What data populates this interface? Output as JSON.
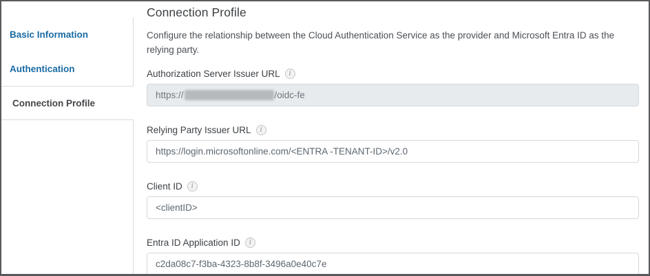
{
  "sidebar": {
    "items": [
      {
        "label": "Basic Information",
        "active": false
      },
      {
        "label": "Authentication",
        "active": false
      },
      {
        "label": "Connection Profile",
        "active": true
      }
    ]
  },
  "main": {
    "title": "Connection Profile",
    "description": "Configure the relationship between the Cloud Authentication Service as the provider and Microsoft Entra ID as the relying party.",
    "fields": [
      {
        "label": "Authorization Server Issuer URL",
        "state": "disabled",
        "value_prefix": "https://",
        "value_redacted": true,
        "value_suffix": "/oidc-fe"
      },
      {
        "label": "Relying Party Issuer URL",
        "state": "editable",
        "value": "https://login.microsoftonline.com/<ENTRA -TENANT-ID>/v2.0"
      },
      {
        "label": "Client ID",
        "state": "editable",
        "value": "<clientID>"
      },
      {
        "label": "Entra ID Application ID",
        "state": "editable",
        "value": "c2da08c7-f3ba-4323-8b8f-3496a0e40c7e"
      }
    ]
  },
  "icons": {
    "info": "i"
  },
  "colors": {
    "link_blue": "#1a6ba4",
    "active_text": "#424549",
    "divider": "#d8dadc",
    "page_border": "#58595b",
    "disabled_input_bg": "#e8ebee",
    "input_border": "#d4d8dc",
    "redaction_gray": "#b6b9bd"
  }
}
